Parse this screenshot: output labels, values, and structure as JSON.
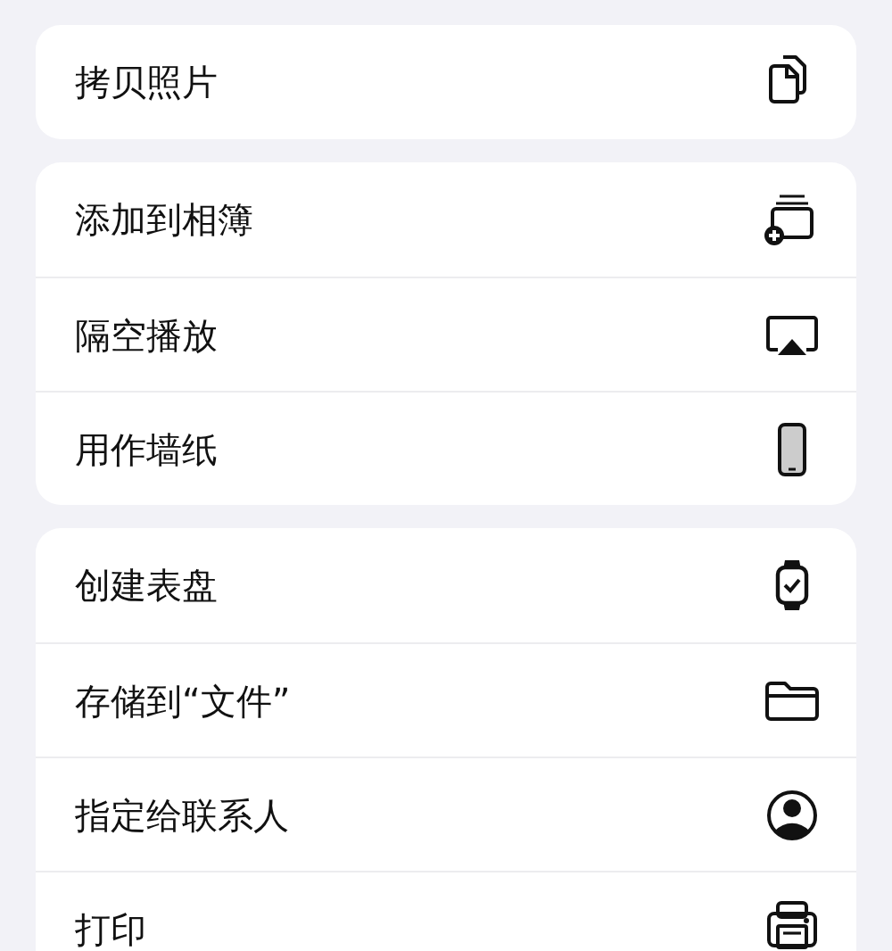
{
  "groups": [
    {
      "items": [
        {
          "label": "拷贝照片"
        }
      ]
    },
    {
      "items": [
        {
          "label": "添加到相簿"
        },
        {
          "label": "隔空播放"
        },
        {
          "label": "用作墙纸"
        }
      ]
    },
    {
      "items": [
        {
          "label": "创建表盘"
        },
        {
          "label": "存储到“文件”"
        },
        {
          "label": "指定给联系人"
        },
        {
          "label": "打印"
        }
      ]
    }
  ]
}
